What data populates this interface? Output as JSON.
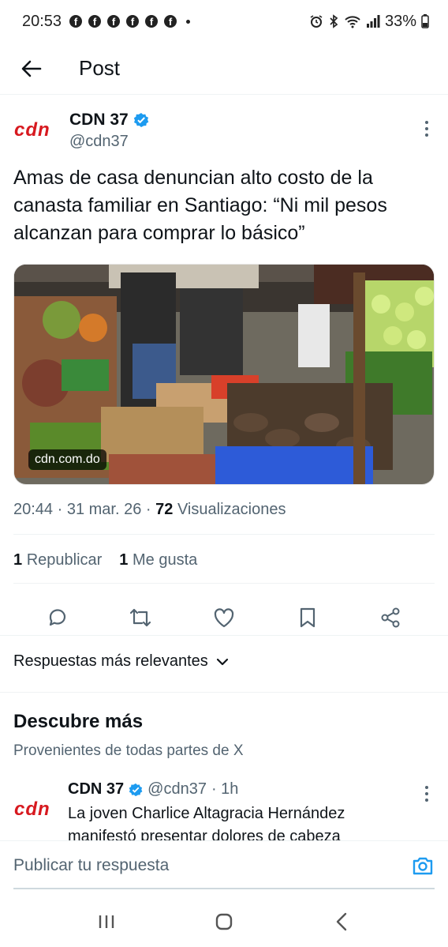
{
  "status": {
    "time": "20:53",
    "notif_icons": [
      "facebook-icon",
      "facebook-icon",
      "facebook-icon",
      "facebook-icon",
      "facebook-icon",
      "facebook-icon"
    ],
    "battery": "33%"
  },
  "header": {
    "title": "Post"
  },
  "tweet": {
    "author_name": "CDN 37",
    "author_handle": "@cdn37",
    "logo_text": "cdn",
    "text": "Amas de casa denuncian alto costo de la canasta familiar en Santiago: “Ni mil pesos alcanzan para comprar lo básico”",
    "media_caption": "cdn.com.do",
    "time": "20:44",
    "date": "31 mar. 26",
    "views_count": "72",
    "views_label": "Visualizaciones",
    "reposts_count": "1",
    "reposts_label": "Republicar",
    "likes_count": "1",
    "likes_label": "Me gusta"
  },
  "replies_sort": {
    "label": "Respuestas más relevantes"
  },
  "discover": {
    "title": "Descubre más",
    "subtitle": "Provenientes de todas partes de X",
    "item": {
      "author_name": "CDN 37",
      "author_handle": "@cdn37",
      "age": "· 1h",
      "text": "La joven Charlice Altagracia Hernández manifestó presentar dolores de cabeza"
    }
  },
  "reply_bar": {
    "placeholder": "Publicar tu respuesta"
  },
  "colors": {
    "brand_red": "#d7191f",
    "verified_blue": "#1d9bf0",
    "text": "#0f1419",
    "muted": "#536471"
  }
}
